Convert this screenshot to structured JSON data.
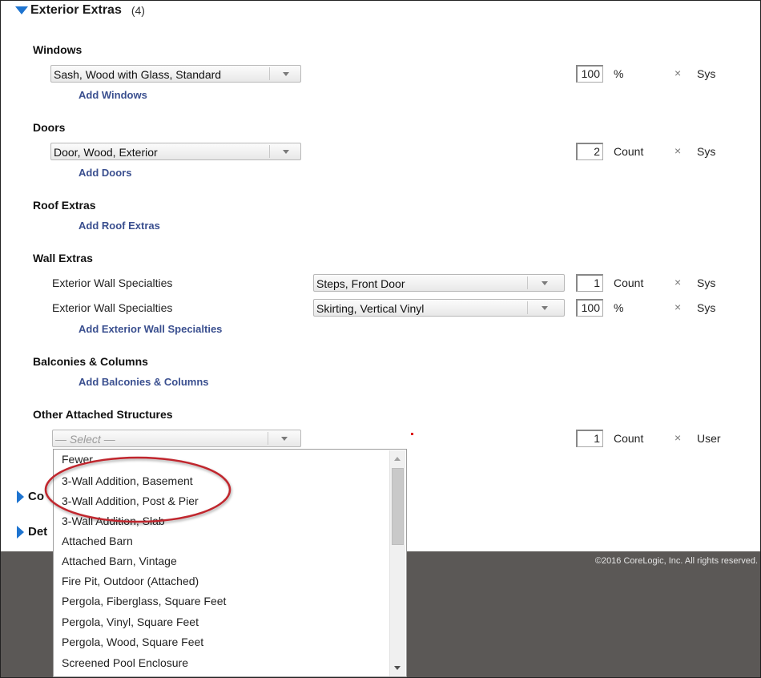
{
  "section": {
    "title": "Exterior Extras",
    "count": "(4)"
  },
  "groups": {
    "windows": {
      "title": "Windows",
      "select": "Sash, Wood with Glass, Standard",
      "qty": "100",
      "unit": "%",
      "x": "×",
      "source": "Sys",
      "add": "Add Windows"
    },
    "doors": {
      "title": "Doors",
      "select": "Door, Wood, Exterior",
      "qty": "2",
      "unit": "Count",
      "x": "×",
      "source": "Sys",
      "add": "Add Doors"
    },
    "roof": {
      "title": "Roof Extras",
      "add": "Add Roof Extras"
    },
    "wall": {
      "title": "Wall Extras",
      "rows": [
        {
          "label": "Exterior Wall Specialties",
          "select": "Steps, Front Door",
          "qty": "1",
          "unit": "Count",
          "x": "×",
          "source": "Sys"
        },
        {
          "label": "Exterior Wall Specialties",
          "select": "Skirting, Vertical Vinyl",
          "qty": "100",
          "unit": "%",
          "x": "×",
          "source": "Sys"
        }
      ],
      "add": "Add Exterior Wall Specialties"
    },
    "balconies": {
      "title": "Balconies & Columns",
      "add": "Add Balconies & Columns"
    },
    "other": {
      "title": "Other Attached Structures",
      "placeholder": "— Select —",
      "qty": "1",
      "unit": "Count",
      "x": "×",
      "source": "User"
    }
  },
  "collapsed": [
    {
      "label": "Co"
    },
    {
      "label": "Det"
    }
  ],
  "dropdown": {
    "options": [
      "Fewer",
      "3-Wall Addition, Basement",
      "3-Wall Addition, Post & Pier",
      "3-Wall Addition, Slab",
      "Attached Barn",
      "Attached Barn, Vintage",
      "Fire Pit, Outdoor (Attached)",
      "Pergola, Fiberglass, Square Feet",
      "Pergola, Vinyl, Square Feet",
      "Pergola, Wood, Square Feet",
      "Screened Pool Enclosure"
    ]
  },
  "footer": {
    "copyright": "©2016 CoreLogic, Inc. All rights reserved."
  },
  "colors": {
    "accent_triangle": "#1e74d0",
    "link": "#3a4f8f",
    "footer_bg": "#5b5856",
    "highlight_ellipse": "#c0282d"
  }
}
